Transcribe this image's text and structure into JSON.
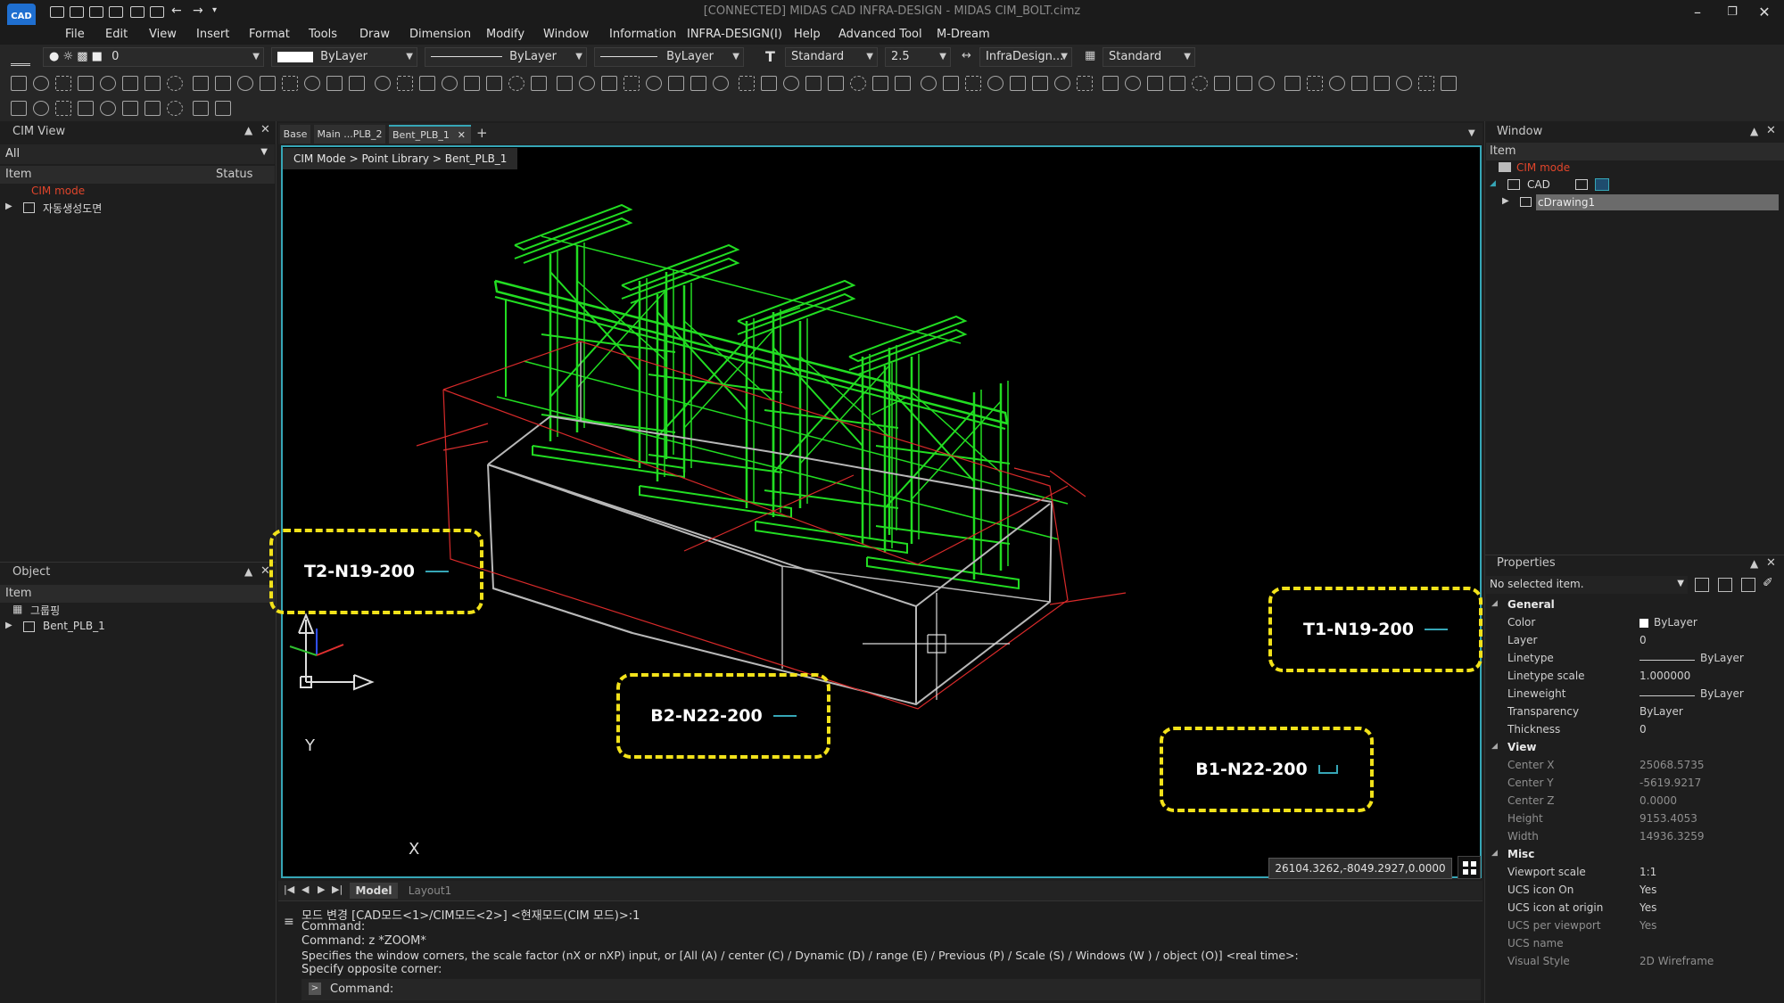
{
  "title_bar": {
    "title": "[CONNECTED] MIDAS CAD INFRA-DESIGN - MIDAS CIM_BOLT.cimz",
    "logo": "CAD"
  },
  "menu": [
    "File",
    "Edit",
    "View",
    "Insert",
    "Format",
    "Tools",
    "Draw",
    "Dimension",
    "Modify",
    "Window",
    "Information",
    "INFRA-DESIGN(I)",
    "Help",
    "Advanced Tool",
    "M-Dream"
  ],
  "toolbar": {
    "layer_value": "0",
    "color_value": "ByLayer",
    "linetype_value": "ByLayer",
    "lineweight_value": "ByLayer",
    "text_style": "Standard",
    "text_height": "2.5",
    "dim_style": "InfraDesign...",
    "table_style": "Standard"
  },
  "cim_view": {
    "title": "CIM View",
    "filter": "All",
    "col_item": "Item",
    "col_status": "Status",
    "items": [
      "CIM mode",
      "자동생성도면"
    ]
  },
  "object_panel": {
    "title": "Object",
    "col_item": "Item",
    "items": [
      "그룹핑",
      "Bent_PLB_1"
    ]
  },
  "tabs": [
    "Base",
    "Main ...PLB_2",
    "Bent_PLB_1"
  ],
  "breadcrumb": "CIM Mode > Point Library > Bent_PLB_1",
  "callouts": {
    "t2": "T2-N19-200",
    "t1": "T1-N19-200",
    "b2": "B2-N22-200",
    "b1": "B1-N22-200"
  },
  "axis": {
    "x": "X",
    "y": "Y"
  },
  "coordinates": "26104.3262,-8049.2927,0.0000",
  "layout_tabs": [
    "Model",
    "Layout1"
  ],
  "command": {
    "lines": [
      "모드 변경 [CAD모드<1>/CIM모드<2>] <현재모드(CIM 모드)>:1",
      "Command:",
      "Command:  z *ZOOM*",
      "Specifies the window corners, the scale factor (nX or nXP) input, or [All (A) / center (C) / Dynamic (D) / range (E) / Previous (P) / Scale (S) / Windows (W ) / object (O)] <real time>:",
      "Specify opposite corner:"
    ],
    "prompt": "Command:"
  },
  "window_panel": {
    "title": "Window",
    "col_item": "Item",
    "tree": [
      "CIM mode",
      "CAD",
      "cDrawing1"
    ]
  },
  "properties": {
    "title": "Properties",
    "selection": "No selected item.",
    "sections": {
      "general": "General",
      "view": "View",
      "misc": "Misc"
    },
    "general": [
      [
        "Color",
        "ByLayer"
      ],
      [
        "Layer",
        "0"
      ],
      [
        "Linetype",
        "ByLayer"
      ],
      [
        "Linetype scale",
        "1.000000"
      ],
      [
        "Lineweight",
        "ByLayer"
      ],
      [
        "Transparency",
        "ByLayer"
      ],
      [
        "Thickness",
        "0"
      ]
    ],
    "view": [
      [
        "Center X",
        "25068.5735"
      ],
      [
        "Center Y",
        "-5619.9217"
      ],
      [
        "Center Z",
        "0.0000"
      ],
      [
        "Height",
        "9153.4053"
      ],
      [
        "Width",
        "14936.3259"
      ]
    ],
    "misc": [
      [
        "Viewport scale",
        "1:1"
      ],
      [
        "UCS icon On",
        "Yes"
      ],
      [
        "UCS icon at origin",
        "Yes"
      ],
      [
        "UCS per viewport",
        "Yes"
      ],
      [
        "UCS name",
        ""
      ],
      [
        "Visual Style",
        "2D Wireframe"
      ]
    ]
  },
  "colors": {
    "accent": "#36a6b6",
    "callout": "#f2e21a",
    "structure": "#22dd22",
    "cim_mode": "#e0452b"
  }
}
